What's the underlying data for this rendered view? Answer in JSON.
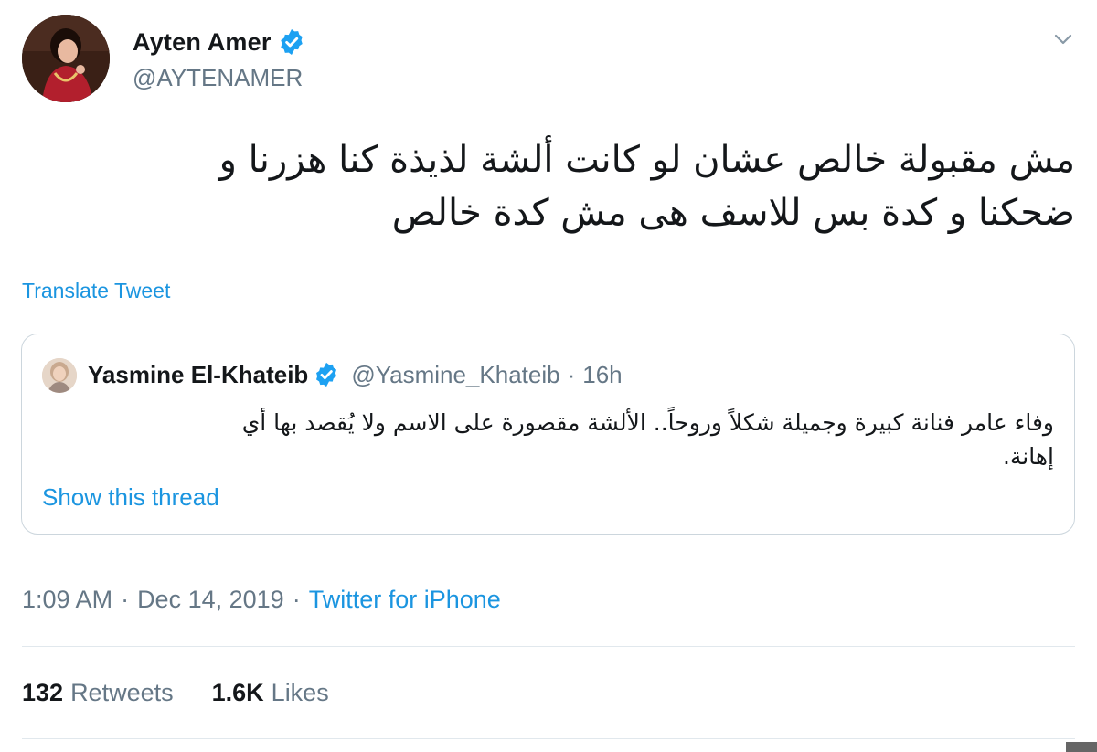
{
  "author": {
    "name": "Ayten Amer",
    "handle": "@AYTENAMER",
    "verified": true,
    "avatar_icon": "avatar-photo"
  },
  "tweet": {
    "text_line1": "مش مقبولة خالص عشان لو كانت ألشة لذيذة كنا هزرنا و",
    "text_line2": "ضحكنا و كدة بس للاسف هى مش كدة خالص",
    "translate_label": "Translate Tweet"
  },
  "quoted": {
    "name": "Yasmine El-Khateib",
    "handle": "@Yasmine_Khateib",
    "dot": "·",
    "time": "16h",
    "text_line1": "وفاء عامر فنانة كبيرة وجميلة شكلاً وروحاً.. الألشة مقصورة على الاسم ولا يُقصد بها أي",
    "text_line2": "إهانة.",
    "show_thread_label": "Show this thread"
  },
  "meta": {
    "time": "1:09 AM",
    "sep1": "·",
    "date": "Dec 14, 2019",
    "sep2": "·",
    "source": "Twitter for iPhone"
  },
  "stats": {
    "retweets_count": "132",
    "retweets_label": "Retweets",
    "likes_count": "1.6K",
    "likes_label": "Likes"
  },
  "colors": {
    "link_blue": "#1b95e0",
    "verified_blue": "#1da1f2",
    "secondary_text": "#657786",
    "border": "#ccd6dd"
  }
}
